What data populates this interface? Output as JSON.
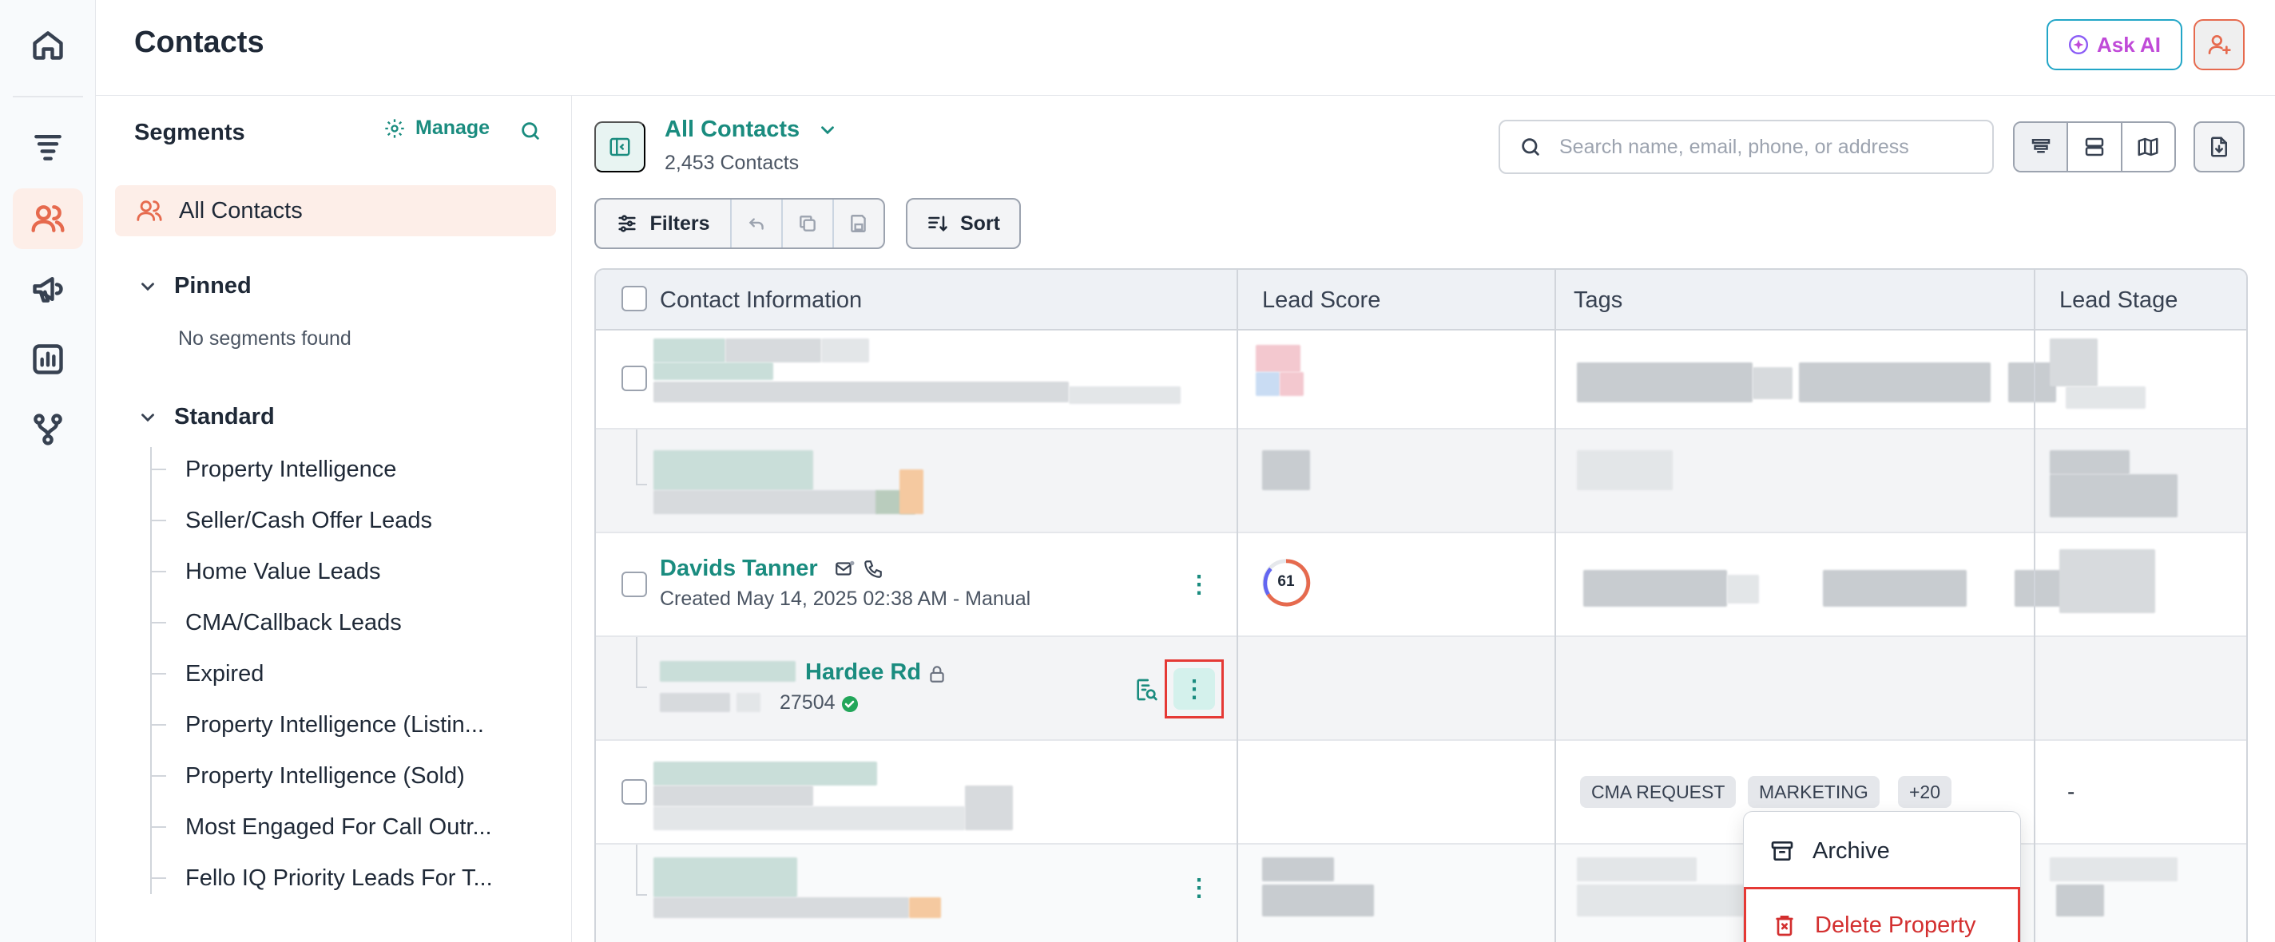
{
  "header": {
    "title": "Contacts",
    "ask_ai_label": "Ask AI"
  },
  "rail": {
    "items": [
      "home-icon",
      "funnel-icon",
      "contacts-icon",
      "megaphone-icon",
      "reports-icon",
      "workflow-icon"
    ],
    "active": "contacts-icon"
  },
  "segments": {
    "title": "Segments",
    "manage_label": "Manage",
    "all_label": "All Contacts",
    "pinned_label": "Pinned",
    "pinned_empty": "No segments found",
    "standard_label": "Standard",
    "standard_items": [
      "Property Intelligence",
      "Seller/Cash Offer Leads",
      "Home Value Leads",
      "CMA/Callback Leads",
      "Expired",
      "Property Intelligence (Listin...",
      "Property Intelligence (Sold)",
      "Most Engaged For Call Outr...",
      "Fello IQ Priority Leads For T..."
    ]
  },
  "view": {
    "name": "All Contacts",
    "count": "2,453 Contacts"
  },
  "search": {
    "placeholder": "Search name, email, phone, or address",
    "value": ""
  },
  "toolbar": {
    "filters_label": "Filters",
    "sort_label": "Sort"
  },
  "table": {
    "columns": [
      "Contact Information",
      "Lead Score",
      "Tags",
      "Lead Stage"
    ],
    "contact_row": {
      "name": "Davids Tanner",
      "created": "Created May 14, 2025 02:38 AM - Manual",
      "lead_score": "61"
    },
    "property_row": {
      "address": "Hardee Rd",
      "zip": "27504"
    },
    "row_tags": [
      "CMA REQUEST",
      "MARKETING",
      "+20"
    ],
    "row_stage": "-"
  },
  "context_menu": {
    "archive_label": "Archive",
    "delete_label": "Delete Property"
  },
  "colors": {
    "brand_teal": "#1a8c7f",
    "accent_orange": "#e66a4e",
    "danger_red": "#d32f2f",
    "highlight_box": "#e53935"
  }
}
